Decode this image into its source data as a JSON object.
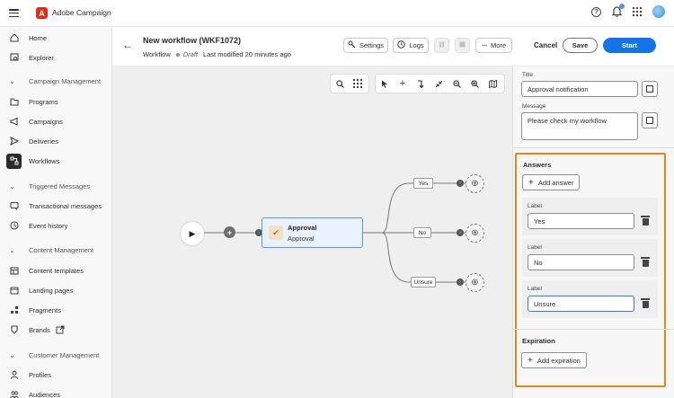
{
  "app": {
    "title": "Adobe Campaign",
    "logo_letter": "A"
  },
  "topbar": {
    "icons": [
      "hamburger-icon",
      "help-icon",
      "bell-icon",
      "app-grid-icon",
      "avatar"
    ]
  },
  "sidebar": {
    "items": [
      {
        "label": "Home",
        "icon": "home-icon"
      },
      {
        "label": "Explorer",
        "icon": "explorer-icon"
      }
    ],
    "sections": [
      {
        "title": "Campaign Management",
        "items": [
          {
            "label": "Programs",
            "icon": "folder-icon"
          },
          {
            "label": "Campaigns",
            "icon": "megaphone-icon"
          },
          {
            "label": "Deliveries",
            "icon": "send-icon"
          },
          {
            "label": "Workflows",
            "icon": "workflow-icon",
            "active": true
          }
        ]
      },
      {
        "title": "Triggered Messages",
        "items": [
          {
            "label": "Transactional messages",
            "icon": "transactional-icon"
          },
          {
            "label": "Event history",
            "icon": "history-icon"
          }
        ]
      },
      {
        "title": "Content Management",
        "items": [
          {
            "label": "Content templates",
            "icon": "template-icon"
          },
          {
            "label": "Landing pages",
            "icon": "landing-page-icon"
          },
          {
            "label": "Fragments",
            "icon": "fragment-icon"
          },
          {
            "label": "Brands",
            "icon": "brand-icon"
          }
        ]
      },
      {
        "title": "Customer Management",
        "items": [
          {
            "label": "Profiles",
            "icon": "profile-icon"
          },
          {
            "label": "Audiences",
            "icon": "audience-icon"
          }
        ]
      }
    ]
  },
  "header": {
    "title": "New workflow (WKF1072)",
    "type": "Workflow",
    "status": "Draft",
    "modified": "Last modified 20 minutes ago",
    "settings_label": "Settings",
    "logs_label": "Logs",
    "more_label": "More",
    "cancel_label": "Cancel",
    "save_label": "Save",
    "start_label": "Start"
  },
  "canvas": {
    "activity": {
      "title": "Approval",
      "subtitle": "Approval"
    },
    "branches": [
      "Yes",
      "No",
      "Unsure"
    ]
  },
  "panel": {
    "title_label": "Title",
    "title_value": "Approval notification",
    "message_label": "Message",
    "message_value": "Please check my workflow",
    "answers_title": "Answers",
    "add_answer_label": "Add answer",
    "answers": [
      {
        "label": "Label",
        "value": "Yes"
      },
      {
        "label": "Label",
        "value": "No"
      },
      {
        "label": "Label",
        "value": "Unsure"
      }
    ],
    "expiration_title": "Expiration",
    "add_expiration_label": "Add expiration"
  },
  "colors": {
    "accent": "#1473e6",
    "highlight": "#e68619",
    "node_border": "#5d95e9"
  }
}
